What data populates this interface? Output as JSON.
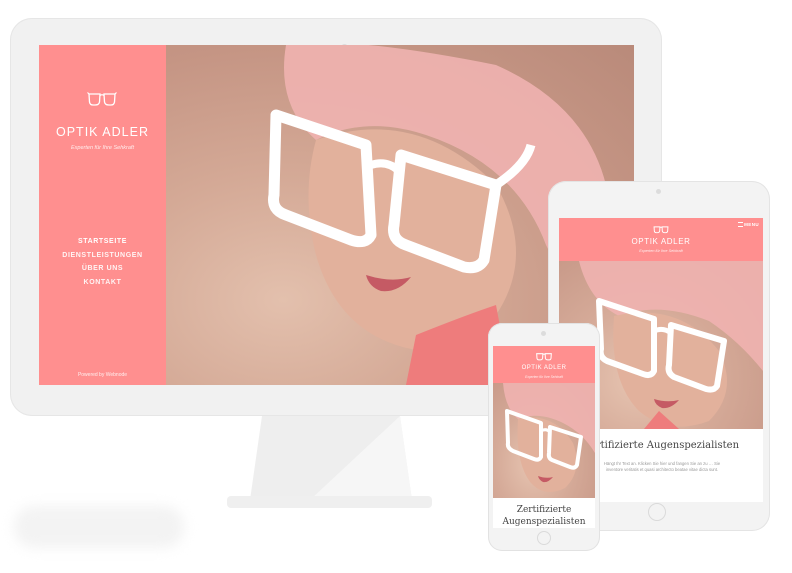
{
  "brand": {
    "name": "OPTIK ADLER",
    "tagline": "Experten für Ihre Sehkraft"
  },
  "desktop": {
    "nav": [
      "STARTSEITE",
      "DIENSTLEISTUNGEN",
      "ÜBER UNS",
      "KONTAKT"
    ],
    "active_nav": "STARTSEITE",
    "powered_by": "Powered by Webnode"
  },
  "tablet": {
    "menu_label": "MENU",
    "heading": "Zertifizierte Augenspezialisten",
    "body": "Hängt Ihr Text an. Klicken Sie hier und fangen Sie an zu … Sie inventore veritatis et quasi architecto beatae vitae dicta sunt."
  },
  "phone": {
    "heading_line1": "Zertifizierte",
    "heading_line2": "Augenspezialisten"
  },
  "colors": {
    "accent": "#ff8f8f",
    "device_frame": "#f1f1f1",
    "photo_tone": "#d4a996",
    "white": "#ffffff"
  },
  "icons": {
    "logo": "glasses-icon",
    "scroll": "chevron-down-icon",
    "menu": "hamburger-icon"
  }
}
